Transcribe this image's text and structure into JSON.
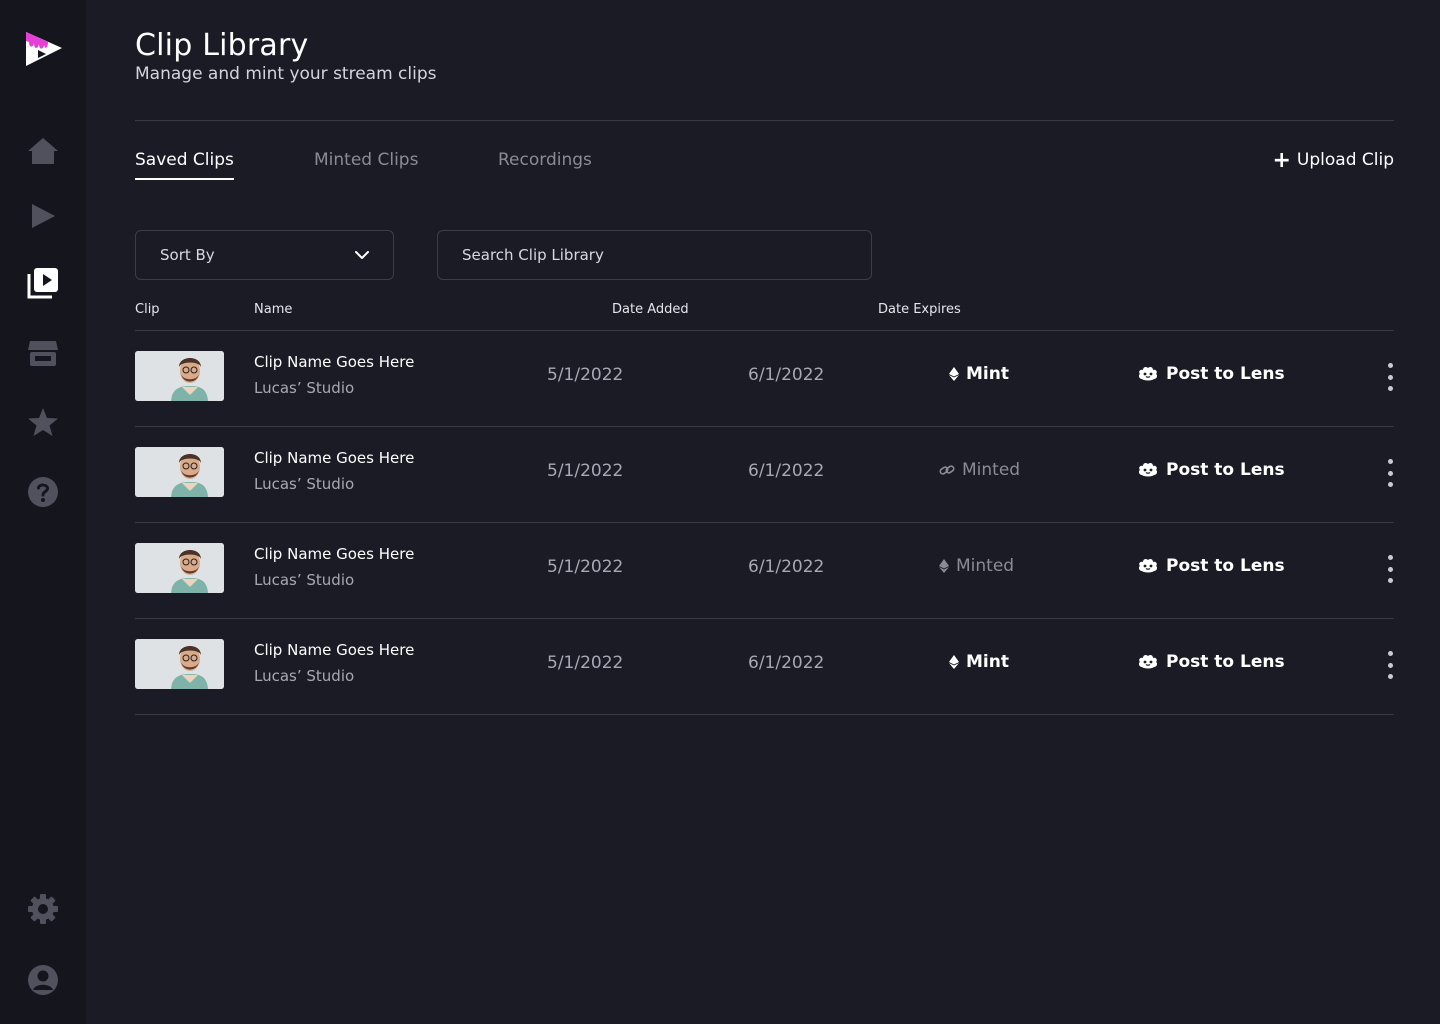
{
  "page": {
    "title": "Clip Library",
    "subtitle": "Manage and mint your stream clips"
  },
  "sidebar": {
    "items": [
      {
        "icon": "home-icon",
        "active": false
      },
      {
        "icon": "play-icon",
        "active": false
      },
      {
        "icon": "clip-library-icon",
        "active": true
      },
      {
        "icon": "store-icon",
        "active": false
      },
      {
        "icon": "star-icon",
        "active": false
      },
      {
        "icon": "help-icon",
        "active": false
      }
    ],
    "bottom_items": [
      {
        "icon": "gear-icon"
      },
      {
        "icon": "account-icon"
      }
    ]
  },
  "tabs": [
    {
      "label": "Saved Clips",
      "active": true
    },
    {
      "label": "Minted Clips",
      "active": false
    },
    {
      "label": "Recordings",
      "active": false
    }
  ],
  "upload_label": "Upload Clip",
  "sort_label": "Sort By",
  "search_placeholder": "Search Clip Library",
  "table": {
    "headers": {
      "clip": "Clip",
      "name": "Name",
      "date_added": "Date Added",
      "date_expires": "Date Expires"
    },
    "rows": [
      {
        "name": "Clip Name Goes Here",
        "studio": "Lucas’ Studio",
        "date_added": "5/1/2022",
        "date_expires": "6/1/2022",
        "status": "mint",
        "status_label": "Mint",
        "status_icon": "ethereum-icon",
        "lens_label": "Post to Lens"
      },
      {
        "name": "Clip Name Goes Here",
        "studio": "Lucas’ Studio",
        "date_added": "5/1/2022",
        "date_expires": "6/1/2022",
        "status": "minted",
        "status_label": "Minted",
        "status_icon": "link-icon",
        "lens_label": "Post to Lens"
      },
      {
        "name": "Clip Name Goes Here",
        "studio": "Lucas’ Studio",
        "date_added": "5/1/2022",
        "date_expires": "6/1/2022",
        "status": "minted",
        "status_label": "Minted",
        "status_icon": "ethereum-icon",
        "lens_label": "Post to Lens"
      },
      {
        "name": "Clip Name Goes Here",
        "studio": "Lucas’ Studio",
        "date_added": "5/1/2022",
        "date_expires": "6/1/2022",
        "status": "mint",
        "status_label": "Mint",
        "status_icon": "ethereum-icon",
        "lens_label": "Post to Lens"
      }
    ]
  },
  "colors": {
    "background": "#1b1b26",
    "sidebar": "#15151e",
    "accent_logo": "#e63fd8",
    "muted_text": "#a8a8b4",
    "divider": "#3a3a47"
  }
}
